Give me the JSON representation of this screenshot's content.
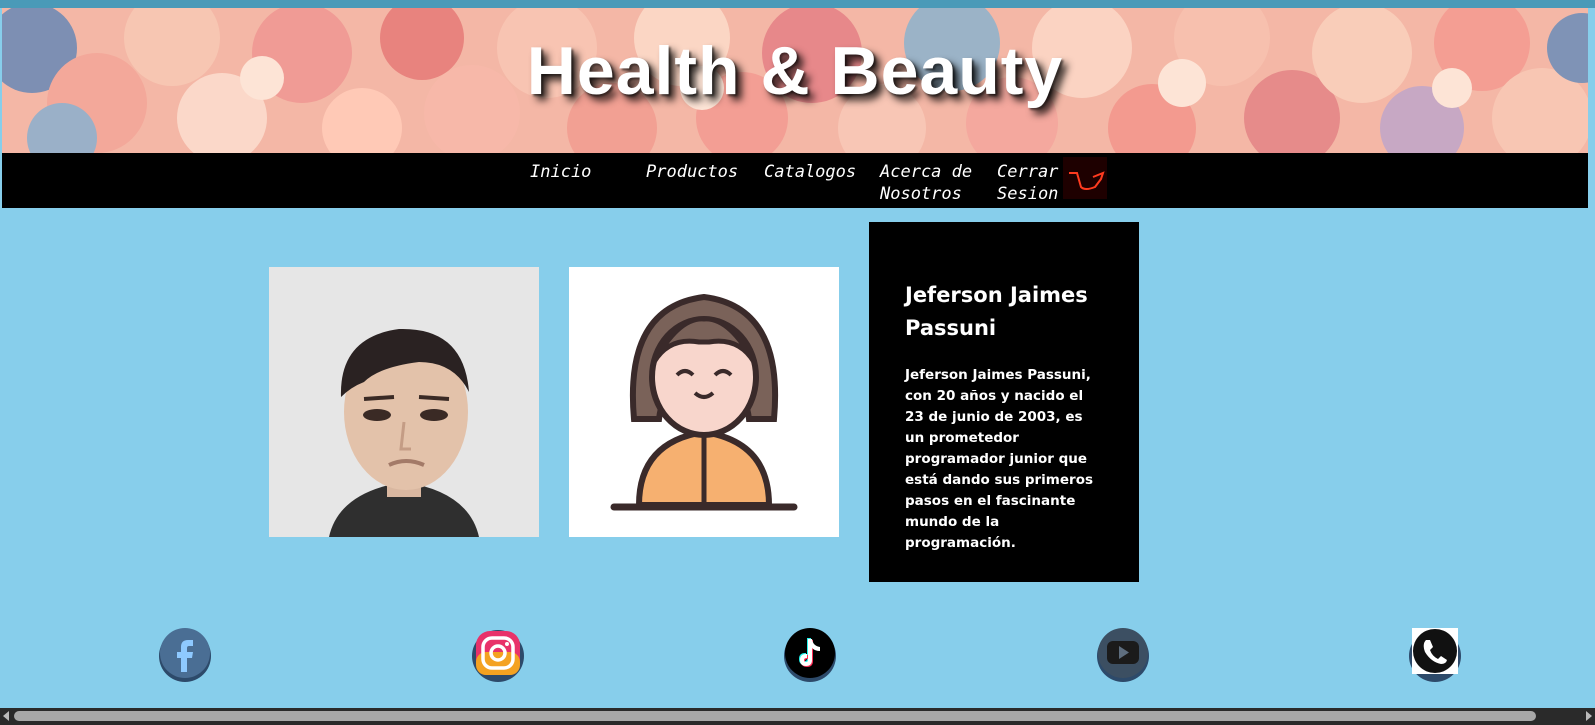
{
  "site": {
    "title": "Health & Beauty"
  },
  "nav": {
    "inicio": "Inicio",
    "productos": "Productos",
    "catalogos": "Catalogos",
    "acerca_line1": "Acerca de",
    "acerca_line2": "Nosotros",
    "cerrar_line1": "Cerrar",
    "cerrar_line2": "Sesion",
    "cart_icon": "shopping-cart-icon"
  },
  "profile": {
    "name": "Jeferson Jaimes Passuni",
    "bio": "Jeferson Jaimes Passuni, con 20 años y nacido el 23 de junio de 2003, es un prometedor programador junior que está dando sus primeros pasos en el fascinante mundo de la programación."
  },
  "social": [
    "facebook-icon",
    "instagram-icon",
    "tiktok-icon",
    "youtube-icon",
    "whatsapp-icon"
  ],
  "colors": {
    "page_bg": "#87CEEB",
    "nav_bg": "#000000",
    "accent": "#ff3b1f"
  }
}
